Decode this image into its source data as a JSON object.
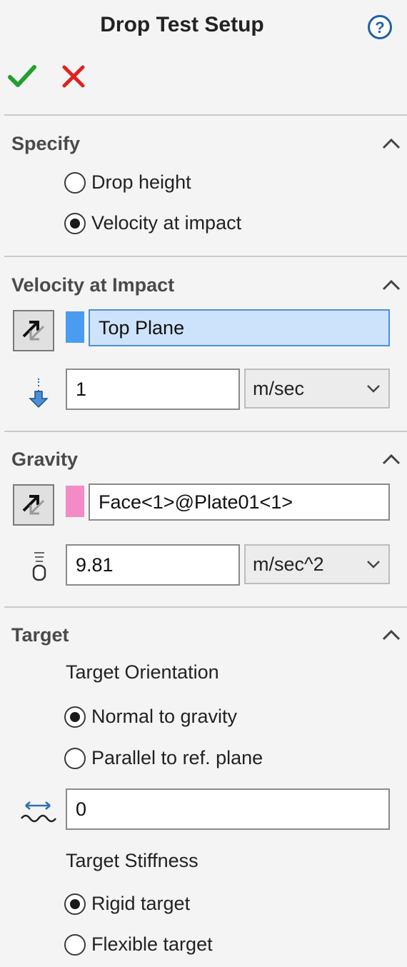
{
  "header": {
    "title": "Drop Test Setup",
    "help_icon": "help-icon",
    "ok_icon": "checkmark-icon",
    "cancel_icon": "close-icon",
    "ok_color": "#22a02e",
    "cancel_color": "#e02020"
  },
  "specify": {
    "title": "Specify",
    "options": [
      {
        "label": "Drop height",
        "selected": false
      },
      {
        "label": "Velocity at impact",
        "selected": true
      }
    ]
  },
  "velocity": {
    "title": "Velocity at Impact",
    "direction_ref": "Top Plane",
    "direction_color": "#4a9cf0",
    "value": "1",
    "unit": "m/sec"
  },
  "gravity": {
    "title": "Gravity",
    "reference": "Face<1>@Plate01<1>",
    "reference_color": "#f28bc6",
    "value": "9.81",
    "unit": "m/sec^2"
  },
  "target": {
    "title": "Target",
    "orientation_label": "Target Orientation",
    "orientation_options": [
      {
        "label": "Normal to gravity",
        "selected": true
      },
      {
        "label": "Parallel to ref. plane",
        "selected": false
      }
    ],
    "offset_value": "0",
    "stiffness_label": "Target Stiffness",
    "stiffness_options": [
      {
        "label": "Rigid target",
        "selected": true
      },
      {
        "label": "Flexible target",
        "selected": false
      }
    ]
  }
}
